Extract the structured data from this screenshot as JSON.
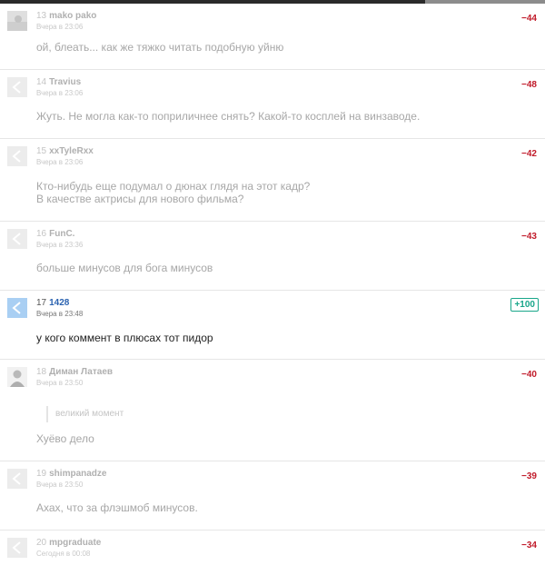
{
  "comments": [
    {
      "num": "13",
      "name": "mako pako",
      "time": "Вчера в 23:06",
      "score": "−44",
      "lines": [
        "ой, блеать... как же тяжко читать подобную уйню"
      ],
      "avatar": "photo"
    },
    {
      "num": "14",
      "name": "Travius",
      "time": "Вчера в 23:06",
      "score": "−48",
      "lines": [
        "Жуть. Не могла как-то поприличнее снять? Какой-то косплей на винзаводе."
      ],
      "avatar": "default"
    },
    {
      "num": "15",
      "name": "xxTyleRxx",
      "time": "Вчера в 23:06",
      "score": "−42",
      "lines": [
        "Кто-нибудь еще подумал о дюнах глядя на этот кадр?",
        "В качестве актрисы для нового фильма?"
      ],
      "avatar": "default"
    },
    {
      "num": "16",
      "name": "FunC.",
      "time": "Вчера в 23:36",
      "score": "−43",
      "lines": [
        "больше минусов для бога минусов"
      ],
      "avatar": "default"
    },
    {
      "num": "17",
      "name": "1428",
      "time": "Вчера в 23:48",
      "score": "+100",
      "lines": [
        "у кого коммент в плюсах тот пидор"
      ],
      "avatar": "default"
    },
    {
      "num": "18",
      "name": "Диман Латаев",
      "time": "Вчера в 23:50",
      "score": "−40",
      "quote": "великий момент",
      "lines": [
        "Хуёво дело"
      ],
      "avatar": "person"
    },
    {
      "num": "19",
      "name": "shimpanadze",
      "time": "Вчера в 23:50",
      "score": "−39",
      "lines": [
        "Ахах, что за флэшмоб минусов."
      ],
      "avatar": "default"
    },
    {
      "num": "20",
      "name": "mpgraduate",
      "time": "Сегодня в 00:08",
      "score": "−34",
      "lines": [],
      "avatar": "default"
    }
  ]
}
